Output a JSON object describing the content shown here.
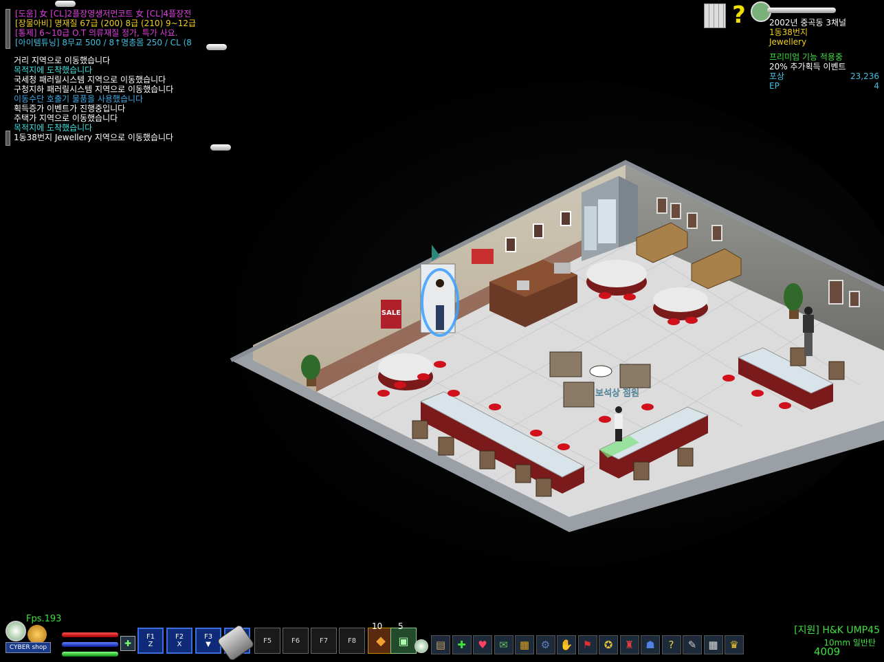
{
  "chat_top": [
    {
      "text": "[도움] 女 [CL]2플장영생저먼코트 女 [CL]4플장전",
      "color": "#e040e0"
    },
    {
      "text": "[장물아비] 명재질 67급 (200) 8급 (210) 9~12급",
      "color": "#f0d020"
    },
    {
      "text": "[통제] 6~10급 O.T 의류재질 정가, 특가 사요.",
      "color": "#e040e0"
    },
    {
      "text": "[아이템튜닝] 8무교 500 / 8↑명총몸 250 / CL (8",
      "color": "#40c0e0"
    }
  ],
  "chat_log": [
    {
      "text": "거리 지역으로 이동했습니다",
      "color": "#ffffff"
    },
    {
      "text": "목적지에 도착했습니다",
      "color": "#40e0e0"
    },
    {
      "text": "국세청 패러릴시스템 지역으로 이동했습니다",
      "color": "#ffffff"
    },
    {
      "text": "구청지하 패러릴시스템 지역으로 이동했습니다",
      "color": "#ffffff"
    },
    {
      "text": "이동수단 호출기 물품을 사용했습니다",
      "color": "#40a8e0"
    },
    {
      "text": "획득증가 이벤트가 진행중입니다",
      "color": "#ffffff"
    },
    {
      "text": "주택가 지역으로 이동했습니다",
      "color": "#ffffff"
    },
    {
      "text": "목적지에 도착했습니다",
      "color": "#40e0e0"
    },
    {
      "text": "1동38번지 Jewellery 지역으로 이동했습니다",
      "color": "#ffffff"
    }
  ],
  "info": {
    "date_channel": "2002년 중곡동 3채널",
    "address": "1동38번지",
    "zone": "Jewellery",
    "premium": "프리미엄 기능 적용중",
    "event": "20% 추가획득 이벤트",
    "reward_label": "포상",
    "reward_value": "23,236",
    "ep_label": "EP",
    "ep_value": "4"
  },
  "scene": {
    "sale_sign": "SALE",
    "npc_label": "보석상 점원"
  },
  "hud": {
    "fps": "Fps.193",
    "shop": "CYBER shop",
    "fkeys": [
      {
        "label": "F1",
        "sub": "Z"
      },
      {
        "label": "F2",
        "sub": "X"
      },
      {
        "label": "F3",
        "sub": "▼"
      },
      {
        "label": "F4",
        "sub": ""
      }
    ],
    "fkeys_plain": [
      "F5",
      "F6",
      "F7",
      "F8"
    ],
    "slot1_count": "10",
    "slot2_count": "5",
    "weapon_prefix": "[지원]",
    "weapon_name": "H&K UMP45",
    "ammo_type": "10mm 일반탄",
    "ammo_count": "4009"
  },
  "toolbar_icons": [
    "box-icon",
    "heal-cross-icon",
    "heart-icon",
    "chat-icon",
    "blocks-icon",
    "gear-icon",
    "handshake-icon",
    "flag-icon",
    "medal-icon",
    "castle-icon",
    "group-icon",
    "question-icon",
    "wrench-icon",
    "calendar-icon",
    "trophy-icon"
  ],
  "colors": {
    "floor": "#dcdcdc",
    "wall_dark": "#5a5a5a",
    "counter_red": "#7a1a1a",
    "text_green": "#40e040",
    "text_yellow": "#f0d020",
    "text_cyan": "#40c0e0"
  }
}
